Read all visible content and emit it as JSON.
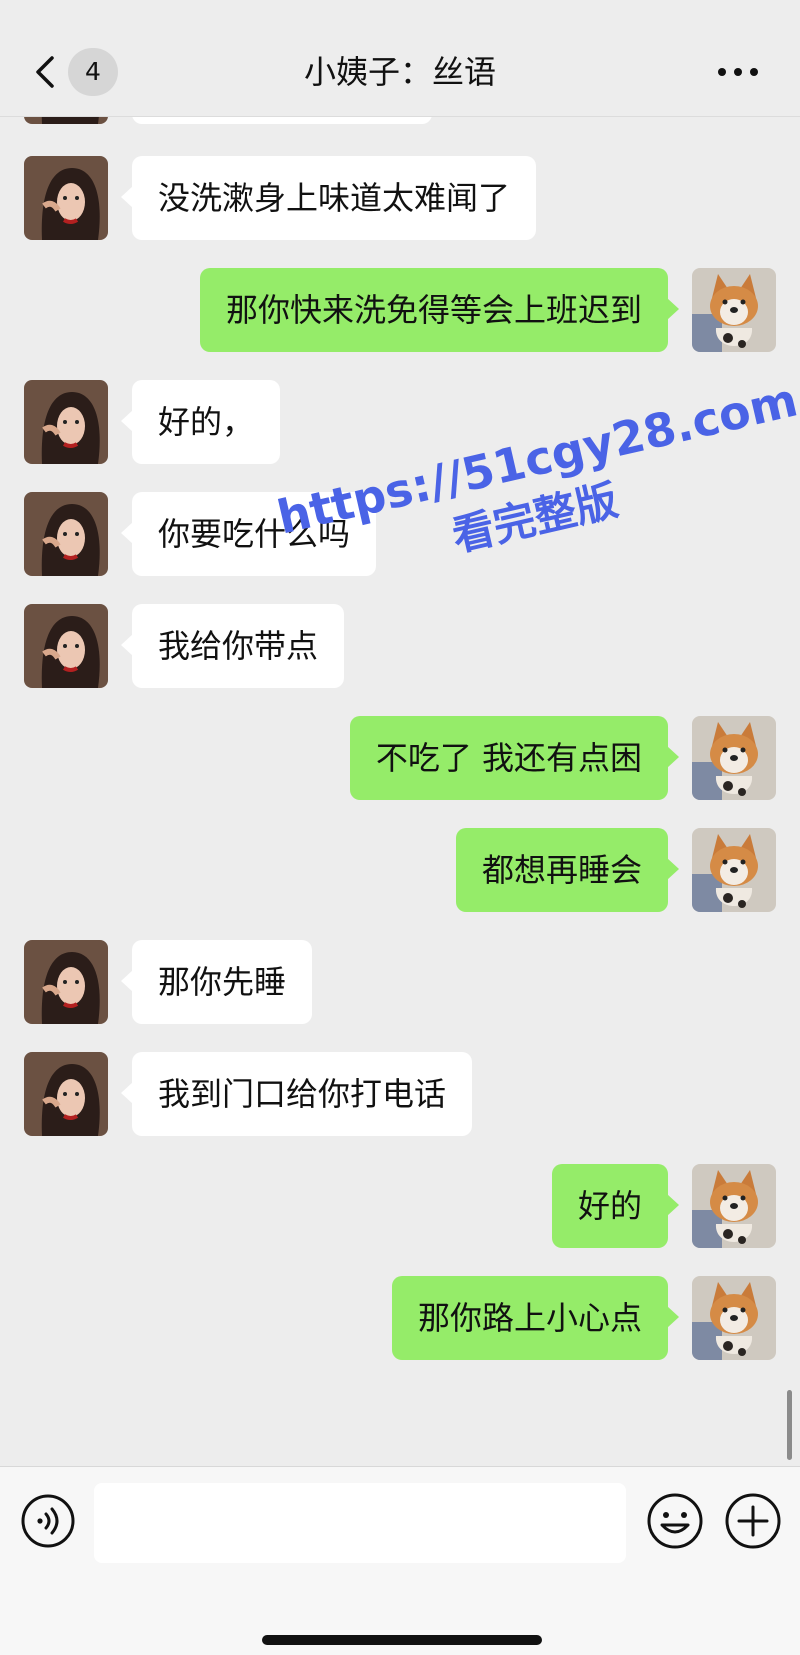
{
  "header": {
    "unread_count": "4",
    "title": "小姨子：丝语"
  },
  "messages": [
    {
      "side": "left",
      "text": ""
    },
    {
      "side": "left",
      "text": "没洗漱身上味道太难闻了"
    },
    {
      "side": "right",
      "text": "那你快来洗免得等会上班迟到"
    },
    {
      "side": "left",
      "text": "好的，"
    },
    {
      "side": "left",
      "text": "你要吃什么吗"
    },
    {
      "side": "left",
      "text": "我给你带点"
    },
    {
      "side": "right",
      "text": "不吃了 我还有点困"
    },
    {
      "side": "right",
      "text": "都想再睡会"
    },
    {
      "side": "left",
      "text": "那你先睡"
    },
    {
      "side": "left",
      "text": "我到门口给你打电话"
    },
    {
      "side": "right",
      "text": "好的"
    },
    {
      "side": "right",
      "text": "那你路上小心点"
    }
  ],
  "watermark": {
    "line1": "https://51cgy28.com",
    "line2": "看完整版"
  },
  "input": {
    "value": ""
  },
  "icons": {
    "back": "chevron-left-icon",
    "more": "more-dots-icon",
    "voice": "voice-icon",
    "emoji": "emoji-icon",
    "plus": "plus-icon",
    "contact_avatar": "woman-portrait-avatar",
    "self_avatar": "corgi-dog-avatar"
  },
  "colors": {
    "background": "#ededed",
    "sent_bubble": "#95ec69",
    "received_bubble": "#ffffff",
    "watermark": "#4a63e6"
  }
}
